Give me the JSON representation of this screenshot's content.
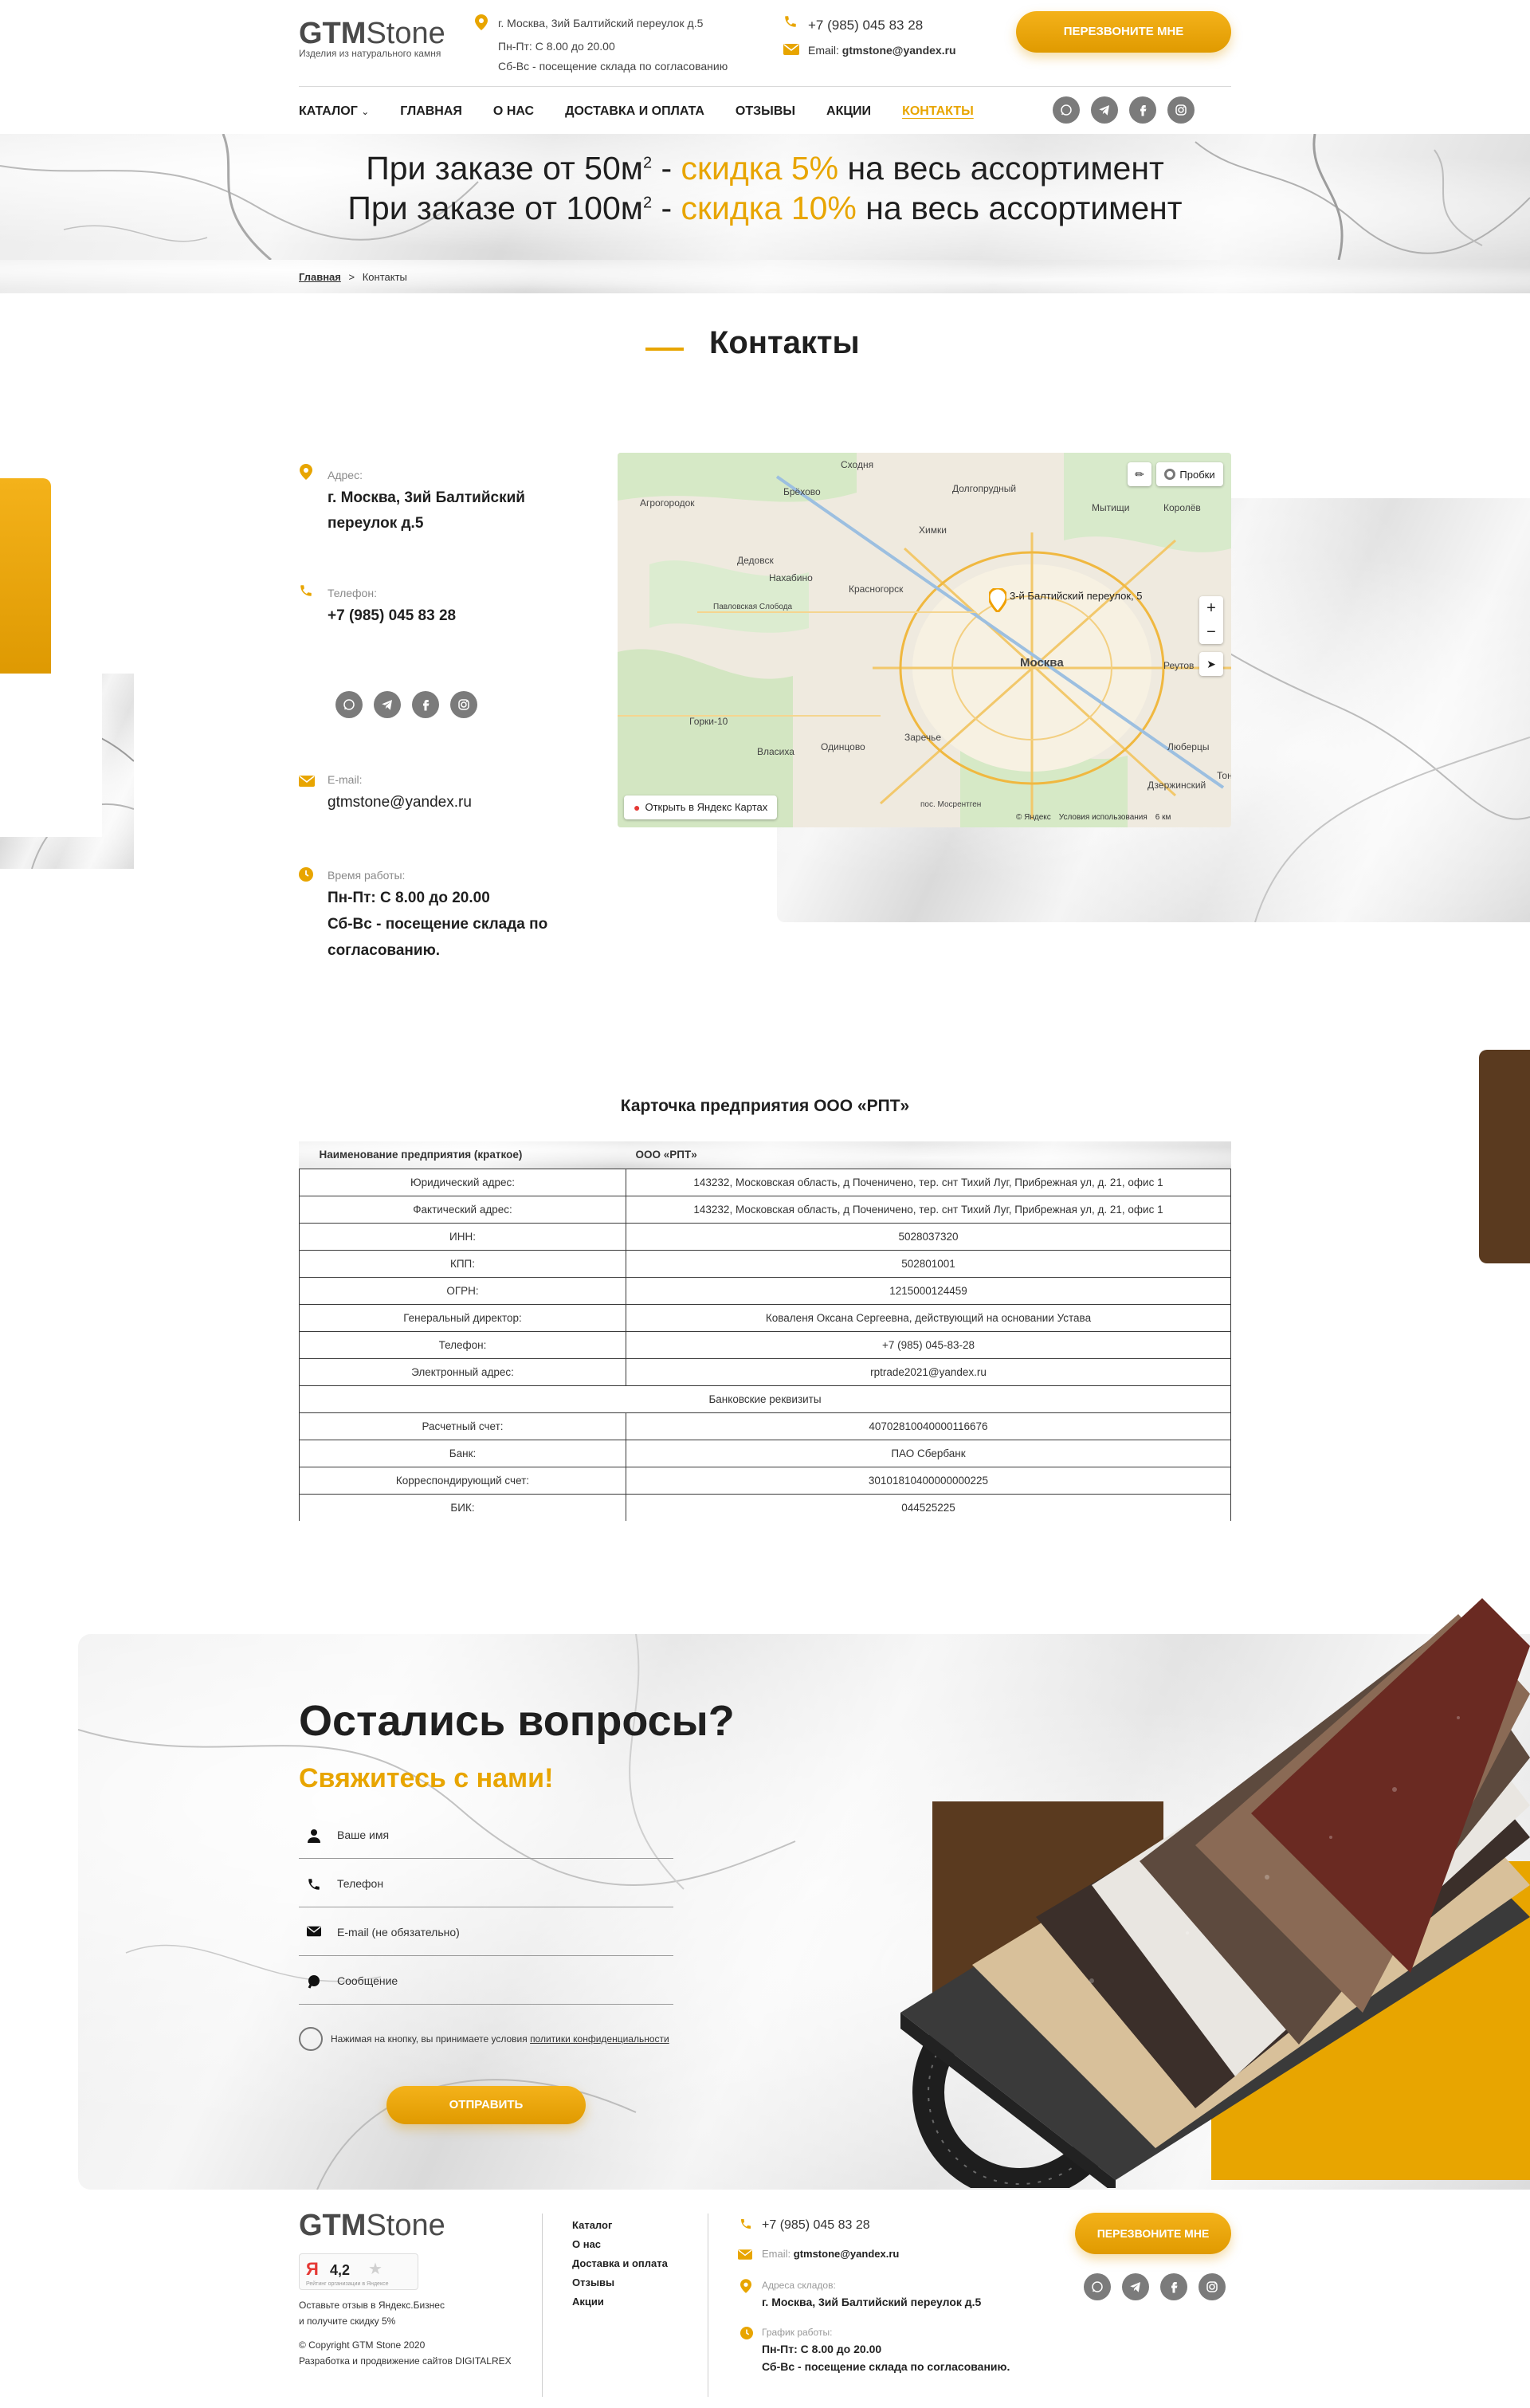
{
  "header": {
    "logo_main": "GTM",
    "logo_sub": "Stone",
    "logo_tagline": "Изделия из натурального камня",
    "address": "г. Москва, 3ий Балтийский переулок д.5",
    "hours_line1": "Пн-Пт: С 8.00 до 20.00",
    "hours_line2": "Сб-Вс - посещение склада по согласованию",
    "phone": "+7 (985) 045 83 28",
    "email_label": "Email:",
    "email": "gtmstone@yandex.ru",
    "callback_button": "Перезвоните мне"
  },
  "nav": {
    "items": [
      "Каталог",
      "Главная",
      "О нас",
      "Доставка и оплата",
      "Отзывы",
      "Акции",
      "Контакты"
    ],
    "active_index": 6
  },
  "promo": {
    "line1_a": "При заказе от 50м",
    "line1_sup": "2",
    "line1_b": " - ",
    "line1_discount": "скидка 5%",
    "line1_c": " на весь ассортимент",
    "line2_a": "При заказе от 100м",
    "line2_sup": "2",
    "line2_b": " - ",
    "line2_discount": "скидка 10%",
    "line2_c": " на весь ассортимент"
  },
  "breadcrumb": {
    "home": "Главная",
    "separator": ">",
    "current": "Контакты"
  },
  "page_title": "Контакты",
  "contacts": {
    "address_label": "Адрес:",
    "address_line1": "г. Москва, 3ий Балтийский",
    "address_line2": "переулок д.5",
    "phone_label": "Телефон:",
    "phone": "+7 (985) 045 83 28",
    "email_label": "E-mail:",
    "email": "gtmstone@yandex.ru",
    "hours_label": "Время работы:",
    "hours_line1": "Пн-Пт: С 8.00 до 20.00",
    "hours_line2": "Сб-Вс - посещение склада по",
    "hours_line3": "согласованию."
  },
  "map": {
    "traffic_button": "Пробки",
    "marker_label": "3-й Балтийский переулок, 5",
    "open_in_yandex": "Открыть в Яндекс Картах",
    "copyright": "© Яндекс",
    "terms": "Условия использования",
    "scale": "6 км",
    "zoom_in": "+",
    "zoom_out": "−",
    "places": [
      "Сходня",
      "Долгопрудный",
      "Брёхово",
      "Агрогородок",
      "Мытищи",
      "Королёв",
      "Химки",
      "Дедовск",
      "Нахабино",
      "Красногорск",
      "Павловская Слобода",
      "Москва",
      "Реутов",
      "Горки-10",
      "Власиха",
      "Одинцово",
      "Заречье",
      "Люберцы",
      "Дзержинский",
      "пос. Мосрентген",
      "Тон"
    ]
  },
  "company_card": {
    "title": "Карточка предприятия ООО «РПТ»",
    "rows": [
      [
        "Наименование предприятия (краткое)",
        "ООО «РПТ»"
      ],
      [
        "Юридический адрес:",
        "143232, Московская область, д Поченичено, тер. снт Тихий Луг, Прибрежная ул, д. 21, офис 1"
      ],
      [
        "Фактический адрес:",
        "143232, Московская область, д Поченичено, тер. снт Тихий Луг, Прибрежная ул, д. 21, офис 1"
      ],
      [
        "ИНН:",
        "5028037320"
      ],
      [
        "КПП:",
        "502801001"
      ],
      [
        "ОГРН:",
        "1215000124459"
      ],
      [
        "Генеральный директор:",
        "Коваленя Оксана Сергеевна, действующий на основании Устава"
      ],
      [
        "Телефон:",
        "+7 (985) 045-83-28"
      ],
      [
        "Электронный адрес:",
        "rptrade2021@yandex.ru"
      ],
      [
        "Банковские реквизиты",
        ""
      ],
      [
        "Расчетный счет:",
        "40702810040000116676"
      ],
      [
        "Банк:",
        "ПАО Сбербанк"
      ],
      [
        "Корреспондирующий счет:",
        "30101810400000000225"
      ],
      [
        "БИК:",
        "044525225"
      ]
    ]
  },
  "questions": {
    "title": "Остались вопросы?",
    "subtitle": "Свяжитесь с нами!",
    "name_placeholder": "Ваше имя",
    "phone_placeholder": "Телефон",
    "email_placeholder": "E-mail (не обязательно)",
    "message_placeholder": "Сообщение",
    "consent_text": "Нажимая на кнопку, вы принимаете условия ",
    "consent_link": "политики конфиденциальности",
    "submit_button": "Отправить"
  },
  "footer": {
    "logo_main": "GTM",
    "logo_sub": "Stone",
    "rating": "4,2",
    "rating_caption": "Рейтинг организации в Яндексе",
    "review_line1": "Оставьте отзыв в Яндекс.Бизнес",
    "review_line2": "и получите скидку 5%",
    "copyright": "© Copyright GTM Stone 2020",
    "developer": "Разработка и продвижение сайтов DIGITALREX",
    "menu": [
      "Каталог",
      "О нас",
      "Доставка и оплата",
      "Отзывы",
      "Акции"
    ],
    "phone": "+7 (985) 045 83 28",
    "email_label": "Email:",
    "email": "gtmstone@yandex.ru",
    "address_label": "Адреса складов:",
    "address": "г. Москва, 3ий Балтийский переулок д.5",
    "schedule_label": "График работы:",
    "hours_line1": "Пн-Пт: С 8.00 до 20.00",
    "hours_line2": "Сб-Вс - посещение склада по согласованию.",
    "callback_button": "Перезвоните мне"
  },
  "colors": {
    "accent": "#e8a500",
    "brown": "#5a3a1f",
    "text": "#1f1f1f",
    "social": "#7b7b7b"
  }
}
